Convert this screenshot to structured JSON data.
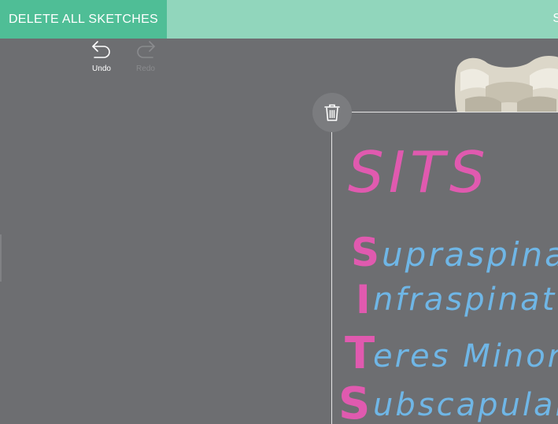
{
  "toolbar": {
    "delete_all_label": "DELETE ALL SKETCHES",
    "right_partial_label": "S",
    "undo_label": "Undo",
    "redo_label": "Redo"
  },
  "icons": {
    "undo": "undo-arrow-icon",
    "redo": "redo-arrow-icon",
    "trash": "trash-icon"
  },
  "sketch": {
    "title": "SITS",
    "lines": [
      {
        "initial": "S",
        "rest": "upraspinat"
      },
      {
        "initial": "I",
        "rest": "nfraspinat"
      },
      {
        "initial": "T",
        "rest": "eres Minor"
      },
      {
        "initial": "S",
        "rest": "ubscapulari"
      }
    ]
  },
  "colors": {
    "background": "#6d6e71",
    "toolbar": "#91d6bc",
    "delete_button": "#4fbe96",
    "ink_pink": "#e05aaf",
    "ink_blue": "#6fb6e6"
  }
}
